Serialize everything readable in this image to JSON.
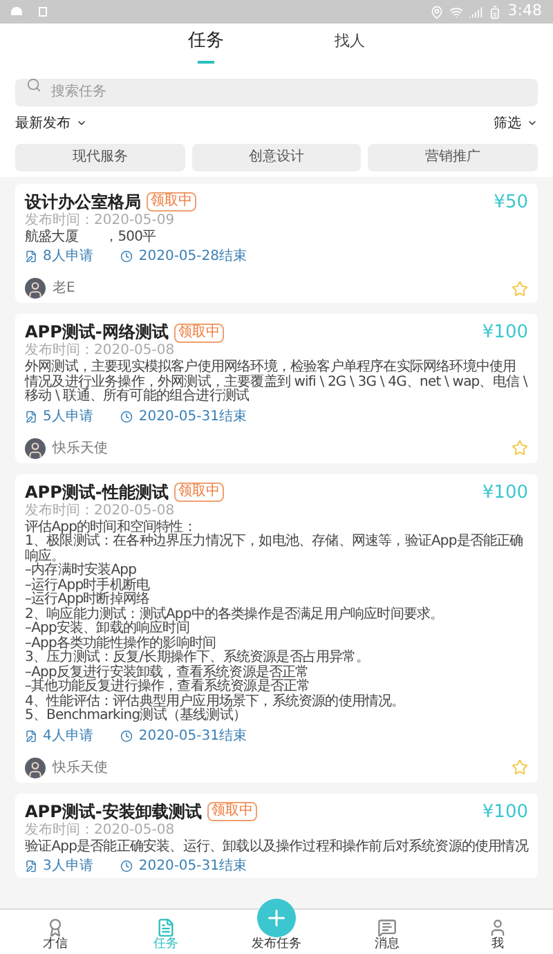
{
  "status_bar": {
    "time": "3:48"
  },
  "tabs": [
    {
      "label": "任务",
      "selected": true
    },
    {
      "label": "找人",
      "selected": false
    }
  ],
  "search": {
    "placeholder": "搜索任务"
  },
  "sort": {
    "label": "最新发布"
  },
  "filter": {
    "label": "筛选"
  },
  "categories": [
    "现代服务",
    "创意设计",
    "营销推广"
  ],
  "tasks": [
    {
      "title": "设计办公室格局",
      "badge": "领取中",
      "price": "¥50",
      "date": "发布时间：2020-05-09",
      "description": "航盛大厦　　，500平",
      "applicants": "8人申请",
      "deadline": "2020-05-28结束",
      "author": "老E"
    },
    {
      "title": "APP测试-网络测试",
      "badge": "领取中",
      "price": "¥100",
      "date": "发布时间：2020-05-08",
      "description": "外网测试，主要现实模拟客户使用网络环境，检验客户单程序在实际网络环境中使用情况及进行业务操作，外网测试，主要覆盖到 wifi \\ 2G \\ 3G \\ 4G、net \\ wap、电信 \\ 移动 \\ 联通、所有可能的组合进行测试",
      "applicants": "5人申请",
      "deadline": "2020-05-31结束",
      "author": "快乐天使"
    },
    {
      "title": "APP测试-性能测试",
      "badge": "领取中",
      "price": "¥100",
      "date": "发布时间：2020-05-08",
      "description": "评估App的时间和空间特性：\n1、极限测试：在各种边界压力情况下，如电池、存储、网速等，验证App是否能正确响应。\n–内存满时安装App\n–运行App时手机断电\n–运行App时断掉网络\n2、响应能力测试：测试App中的各类操作是否满足用户响应时间要求。\n–App安装、卸载的响应时间\n–App各类功能性操作的影响时间\n3、压力测试：反复/长期操作下、系统资源是否占用异常。\n–App反复进行安装卸载，查看系统资源是否正常\n–其他功能反复进行操作，查看系统资源是否正常\n4、性能评估：评估典型用户应用场景下，系统资源的使用情况。\n5、Benchmarking测试（基线测试）",
      "applicants": "4人申请",
      "deadline": "2020-05-31结束",
      "author": "快乐天使"
    },
    {
      "title": "APP测试-安装卸载测试",
      "badge": "领取中",
      "price": "¥100",
      "date": "发布时间：2020-05-08",
      "description": "验证App是否能正确安装、运行、卸载以及操作过程和操作前后对系统资源的使用情况",
      "applicants": "3人申请",
      "deadline": "2020-05-31结束"
    }
  ],
  "nav": [
    {
      "label": "才信",
      "kind": "plain",
      "selected": false
    },
    {
      "label": "任务",
      "kind": "plain",
      "selected": true
    },
    {
      "label": "发布任务",
      "kind": "fab",
      "selected": false
    },
    {
      "label": "消息",
      "kind": "plain",
      "selected": false
    },
    {
      "label": "我",
      "kind": "plain",
      "selected": false
    }
  ]
}
